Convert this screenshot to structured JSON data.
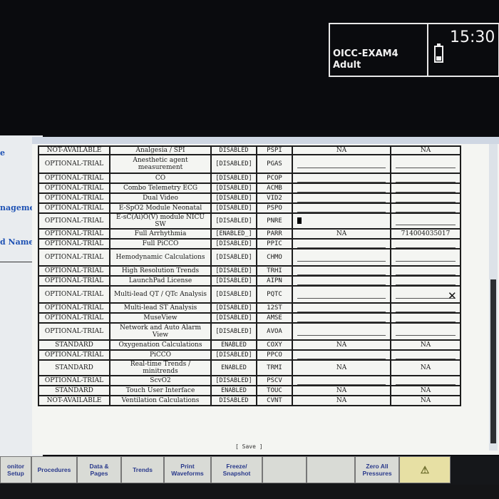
{
  "status": {
    "bed_label": "OICC-EXAM4",
    "patient_category": "Adult",
    "time": "15:30"
  },
  "left_panel": {
    "labels": [
      "e",
      "nagement",
      "d Name"
    ]
  },
  "table": {
    "rows": [
      {
        "status": "NOT-AVAILABLE",
        "feature": "Analgesia / SPI",
        "state": "DISABLED",
        "code": "PSPI",
        "v1": "NA",
        "v2": "NA"
      },
      {
        "status": "OPTIONAL-TRIAL",
        "feature": "Anesthetic agent measurement",
        "state": "[DISABLED]",
        "code": "PGAS",
        "v1": "",
        "v2": ""
      },
      {
        "status": "OPTIONAL-TRIAL",
        "feature": "CO",
        "state": "[DISABLED]",
        "code": "PCOP",
        "v1": "",
        "v2": ""
      },
      {
        "status": "OPTIONAL-TRIAL",
        "feature": "Combo Telemetry ECG",
        "state": "[DISABLED]",
        "code": "ACMB",
        "v1": "",
        "v2": ""
      },
      {
        "status": "OPTIONAL-TRIAL",
        "feature": "Dual Video",
        "state": "[DISABLED]",
        "code": "VID2",
        "v1": "",
        "v2": ""
      },
      {
        "status": "OPTIONAL-TRIAL",
        "feature": "E-SpO2 Module Neonatal",
        "state": "[DISABLED]",
        "code": "PSPO",
        "v1": "",
        "v2": ""
      },
      {
        "status": "OPTIONAL-TRIAL",
        "feature": "E-sC(Ai)O(V) module NICU SW",
        "state": "[DISABLED]",
        "code": "PNRE",
        "v1": "",
        "v2": ""
      },
      {
        "status": "OPTIONAL-TRIAL",
        "feature": "Full Arrhythmia",
        "state": "[ENABLED_]",
        "code": "PARR",
        "v1": "NA",
        "v2": "714004035017"
      },
      {
        "status": "OPTIONAL-TRIAL",
        "feature": "Full PiCCO",
        "state": "[DISABLED]",
        "code": "PPIC",
        "v1": "",
        "v2": ""
      },
      {
        "status": "OPTIONAL-TRIAL",
        "feature": "Hemodynamic Calculations",
        "state": "[DISABLED]",
        "code": "CHMO",
        "v1": "",
        "v2": ""
      },
      {
        "status": "OPTIONAL-TRIAL",
        "feature": "High Resolution Trends",
        "state": "[DISABLED]",
        "code": "TRHI",
        "v1": "",
        "v2": ""
      },
      {
        "status": "OPTIONAL-TRIAL",
        "feature": "LaunchPad License",
        "state": "[DISABLED]",
        "code": "AIPN",
        "v1": "",
        "v2": ""
      },
      {
        "status": "OPTIONAL-TRIAL",
        "feature": "Multi-lead QT / QTc Analysis",
        "state": "[DISABLED]",
        "code": "PQTC",
        "v1": "",
        "v2": ""
      },
      {
        "status": "OPTIONAL-TRIAL",
        "feature": "Multi-lead ST Analysis",
        "state": "[DISABLED]",
        "code": "12ST",
        "v1": "",
        "v2": ""
      },
      {
        "status": "OPTIONAL-TRIAL",
        "feature": "MuseView",
        "state": "[DISABLED]",
        "code": "AMSE",
        "v1": "",
        "v2": ""
      },
      {
        "status": "OPTIONAL-TRIAL",
        "feature": "Network and Auto Alarm View",
        "state": "[DISABLED]",
        "code": "AVOA",
        "v1": "",
        "v2": ""
      },
      {
        "status": "STANDARD",
        "feature": "Oxygenation Calculations",
        "state": "ENABLED",
        "code": "COXY",
        "v1": "NA",
        "v2": "NA"
      },
      {
        "status": "OPTIONAL-TRIAL",
        "feature": "PiCCO",
        "state": "[DISABLED]",
        "code": "PPCO",
        "v1": "",
        "v2": ""
      },
      {
        "status": "STANDARD",
        "feature": "Real-time Trends / minitrends",
        "state": "ENABLED",
        "code": "TRMI",
        "v1": "NA",
        "v2": "NA"
      },
      {
        "status": "OPTIONAL-TRIAL",
        "feature": "ScvO2",
        "state": "[DISABLED]",
        "code": "PSCV",
        "v1": "",
        "v2": ""
      },
      {
        "status": "STANDARD",
        "feature": "Touch User Interface",
        "state": "ENABLED",
        "code": "TOUC",
        "v1": "NA",
        "v2": "NA"
      },
      {
        "status": "NOT-AVAILABLE",
        "feature": "Ventilation Calculations",
        "state": "DISABLED",
        "code": "CVNT",
        "v1": "NA",
        "v2": "NA"
      }
    ]
  },
  "save_label": "[ Save ]",
  "keys": [
    {
      "label": "onitor\nSetup"
    },
    {
      "label": "Procedures"
    },
    {
      "label": "Data &\nPages"
    },
    {
      "label": "Trends"
    },
    {
      "label": "Print\nWaveforms"
    },
    {
      "label": "Freeze/\nSnapshot"
    },
    {
      "label": ""
    },
    {
      "label": ""
    },
    {
      "label": "Zero All\nPressures"
    },
    {
      "label": "alarm-icon"
    }
  ],
  "colors": {
    "label_blue": "#1f52b4",
    "key_text": "#2a3a8c",
    "alarm_key": "#e7e0a4"
  }
}
